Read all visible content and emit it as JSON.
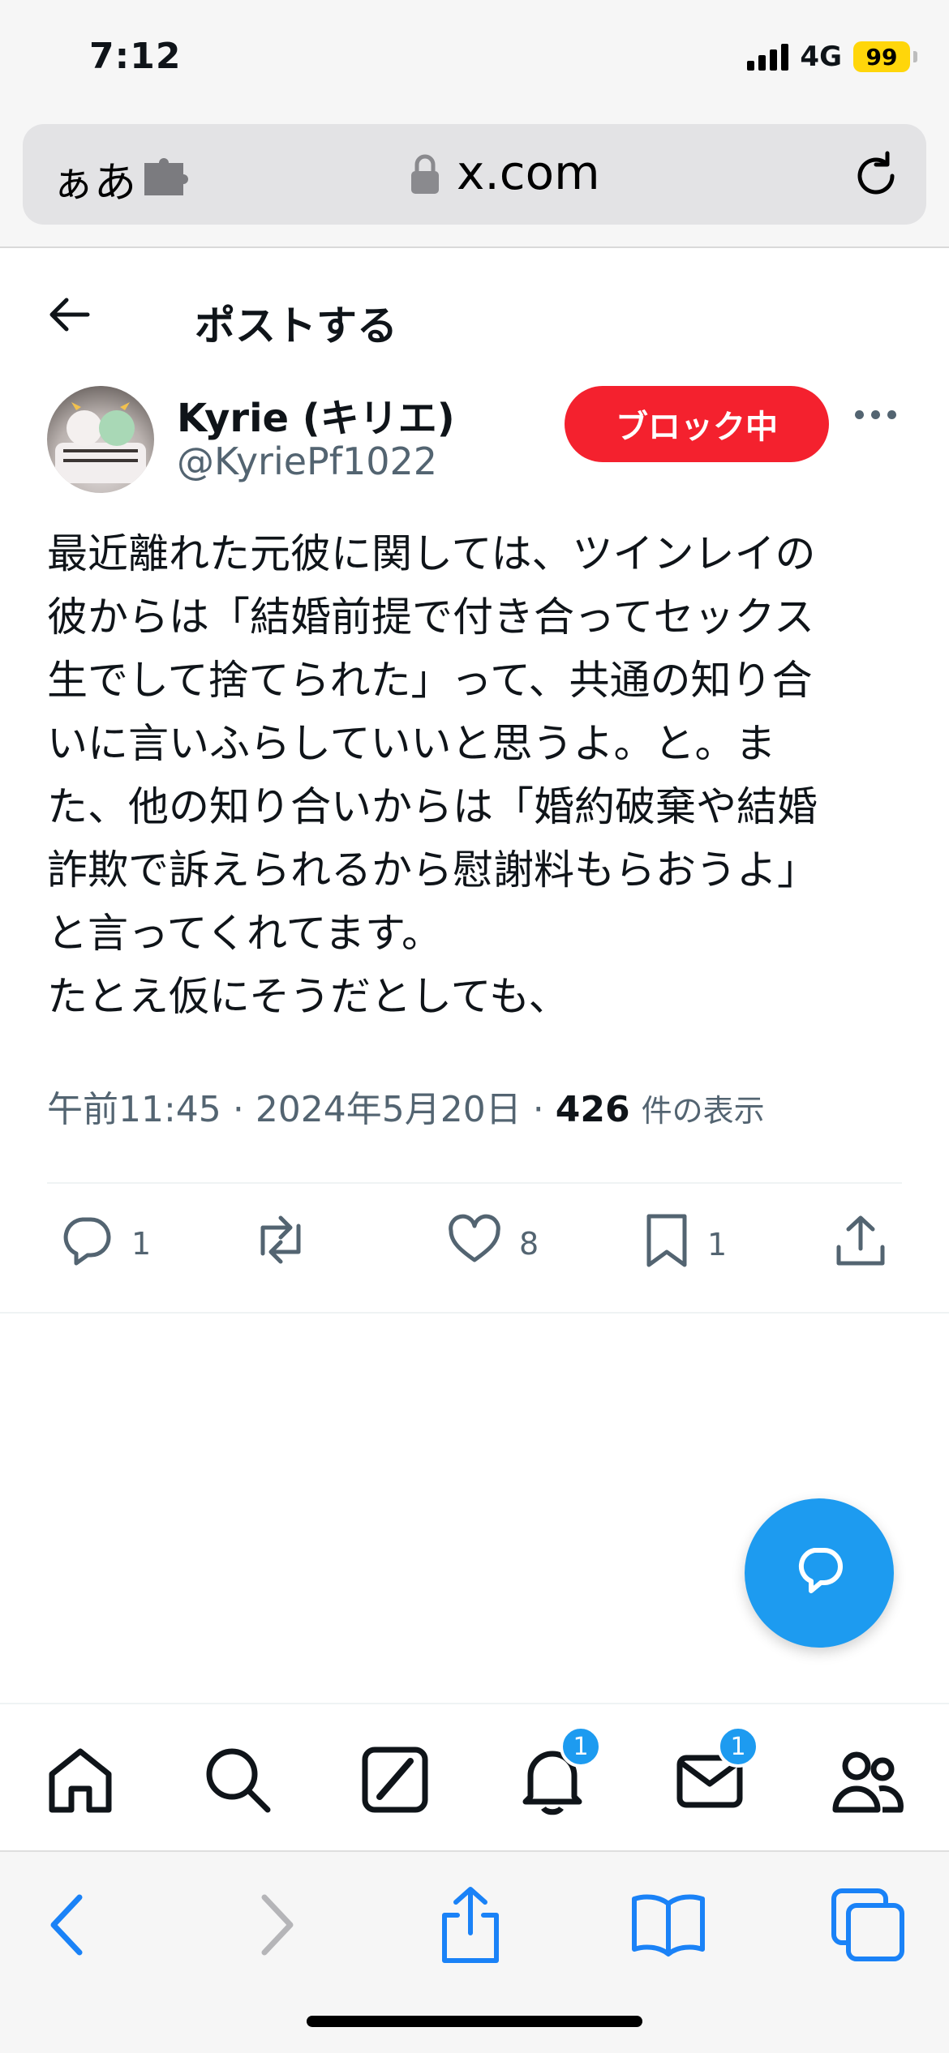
{
  "status_bar": {
    "time": "7:12",
    "network": "4G",
    "battery": "99"
  },
  "browser": {
    "text_size_label": "ぁあ",
    "url": "x.com"
  },
  "header": {
    "title": "ポストする"
  },
  "post": {
    "user_name": "Kyrie (キリエ)",
    "handle": "@KyriePf1022",
    "block_label": "ブロック中",
    "text_lines": [
      "最近離れた元彼に関しては、ツインレイの",
      "彼からは「結婚前提で付き合ってセックス",
      "生でして捨てられた」って、共通の知り合",
      "いに言いふらしていいと思うよ。と。ま",
      "た、他の知り合いからは「婚約破棄や結婚",
      "詐欺で訴えられるから慰謝料もらおうよ」",
      "と言ってくれてます。",
      "たとえ仮にそうだとしても、"
    ],
    "time": "午前11:45",
    "date": "2024年5月20日",
    "views": "426",
    "views_label": "件の表示",
    "separator": "·"
  },
  "actions": {
    "replies": "1",
    "likes": "8",
    "bookmarks": "1"
  },
  "nav": {
    "notifications_badge": "1",
    "messages_badge": "1"
  },
  "colors": {
    "accent": "#1d9bf0",
    "block_red": "#f4212e",
    "muted": "#536471",
    "safari_blue": "#1a82f7"
  },
  "icons": [
    "back-arrow-icon",
    "more-icon",
    "reply-icon",
    "repost-icon",
    "like-icon",
    "bookmark-icon",
    "share-icon",
    "compose-icon",
    "home-icon",
    "search-icon",
    "grok-icon",
    "notifications-icon",
    "messages-icon",
    "communities-icon"
  ]
}
